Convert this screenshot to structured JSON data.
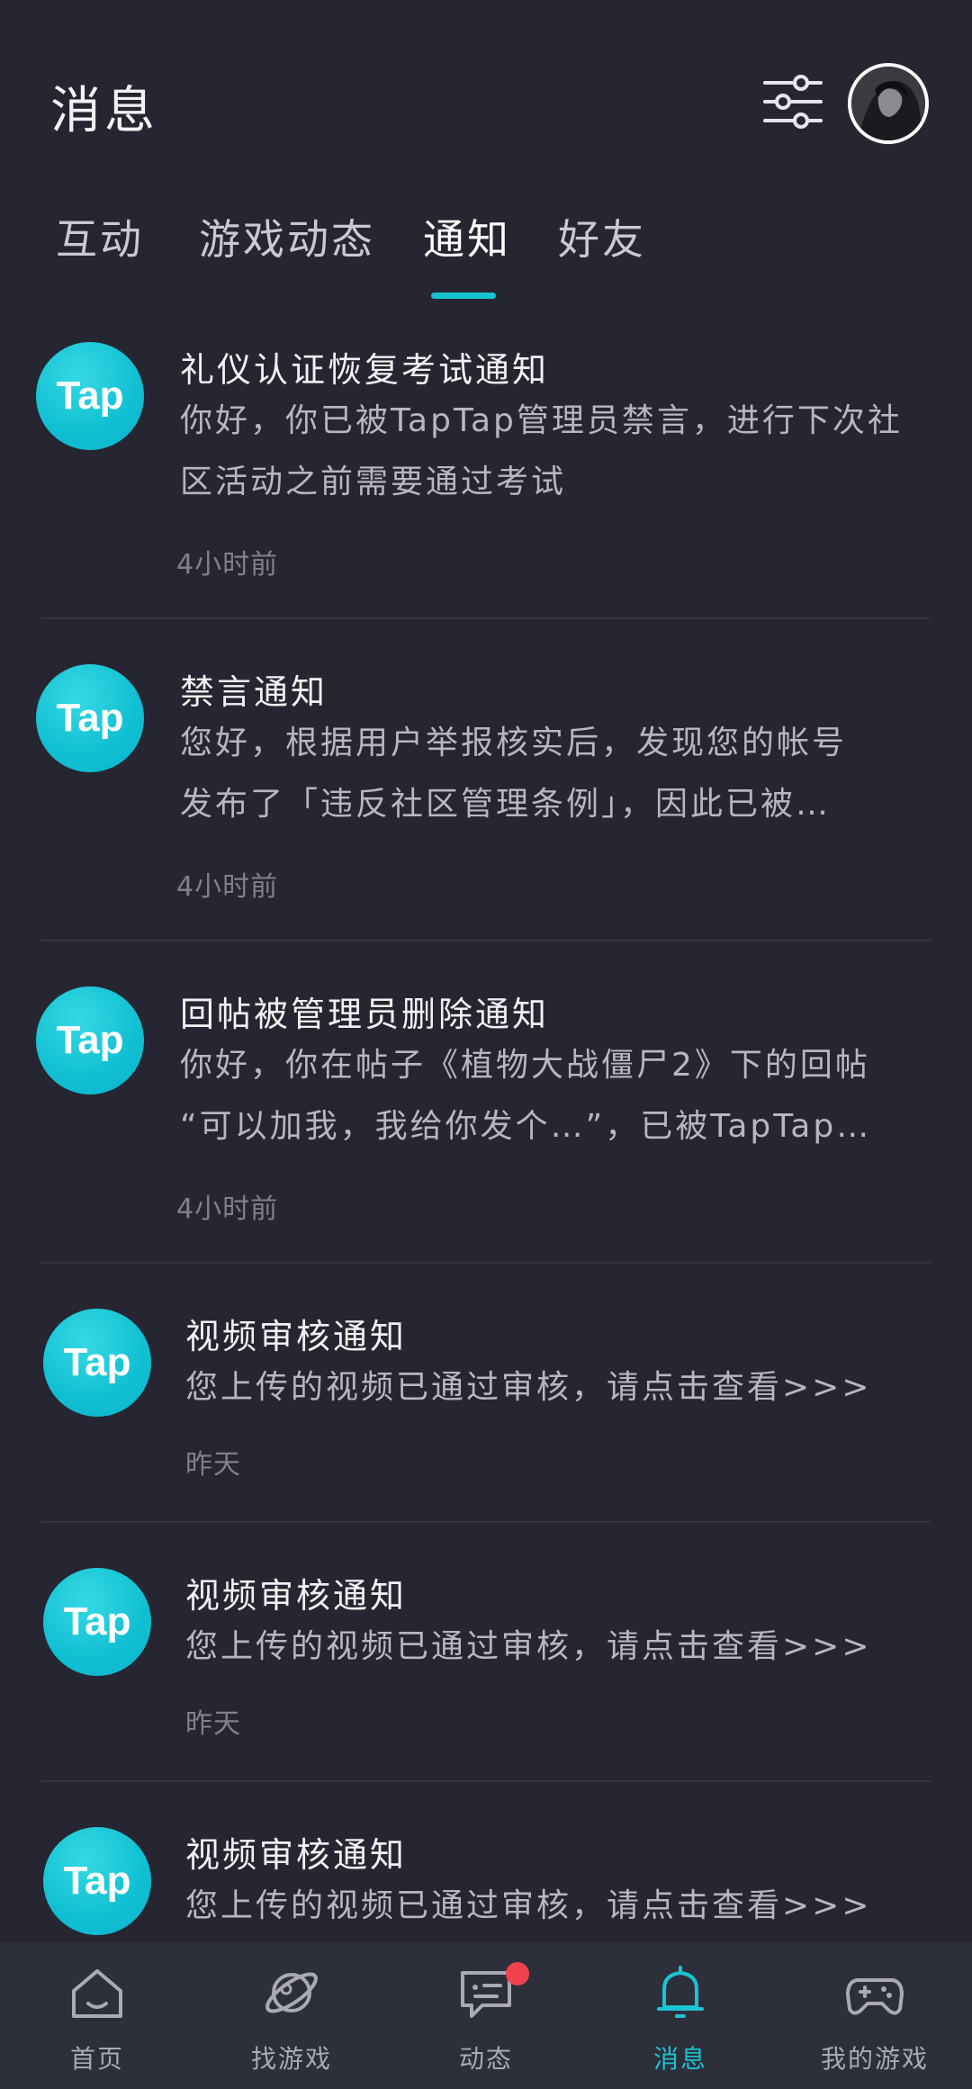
{
  "header": {
    "title": "消息"
  },
  "tabs": [
    {
      "label": "互动",
      "active": false
    },
    {
      "label": "游戏动态",
      "active": false
    },
    {
      "label": "通知",
      "active": true
    },
    {
      "label": "好友",
      "active": false
    }
  ],
  "notifications": [
    {
      "logo_text": "Tap",
      "title": "礼仪认证恢复考试通知",
      "body_lines": [
        "你好，你已被TapTap管理员禁言，进行下次社",
        "区活动之前需要通过考试"
      ],
      "time": "4小时前"
    },
    {
      "logo_text": "Tap",
      "title": "禁言通知",
      "body_lines": [
        "您好，根据用户举报核实后，发现您的帐号",
        "发布了「违反社区管理条例」，因此已被…"
      ],
      "time": "4小时前"
    },
    {
      "logo_text": "Tap",
      "title": "回帖被管理员删除通知",
      "body_lines": [
        "你好，你在帖子《植物大战僵尸2》下的回帖",
        "“可以加我，我给你发个…”，已被TapTap…"
      ],
      "time": "4小时前"
    },
    {
      "logo_text": "Tap",
      "title": "视频审核通知",
      "body_lines": [
        "您上传的视频已通过审核，请点击查看>>>"
      ],
      "time": "昨天"
    },
    {
      "logo_text": "Tap",
      "title": "视频审核通知",
      "body_lines": [
        "您上传的视频已通过审核，请点击查看>>>"
      ],
      "time": "昨天"
    },
    {
      "logo_text": "Tap",
      "title": "视频审核通知",
      "body_lines": [
        "您上传的视频已通过审核，请点击查看>>>"
      ],
      "time": ""
    }
  ],
  "bottom_nav": [
    {
      "label": "首页",
      "icon": "home-icon",
      "active": false
    },
    {
      "label": "找游戏",
      "icon": "planet-icon",
      "active": false
    },
    {
      "label": "动态",
      "icon": "chat-icon",
      "active": false,
      "badge": true
    },
    {
      "label": "消息",
      "icon": "bell-icon",
      "active": true
    },
    {
      "label": "我的游戏",
      "icon": "gamepad-icon",
      "active": false
    }
  ],
  "colors": {
    "background": "#252631",
    "accent": "#15c5ce",
    "tap_logo": "#10bfd2",
    "badge": "#f0424c",
    "nav_background": "#2d2f3b"
  }
}
